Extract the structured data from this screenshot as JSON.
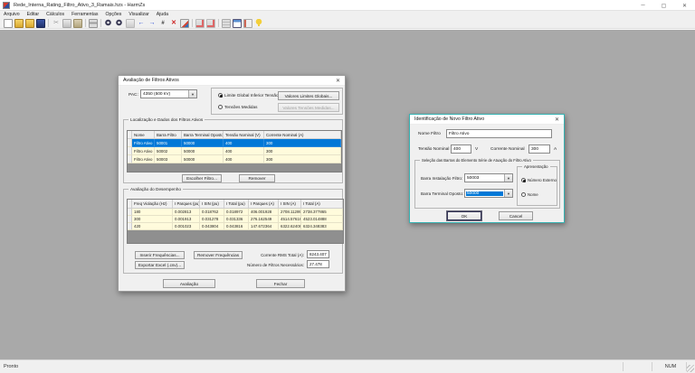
{
  "window": {
    "title": "Rede_Interna_Rating_Filtro_Ativo_3_Ramais.hzs - HarmZs",
    "minimize": "─",
    "maximize": "▢",
    "close": "✕",
    "status_left": "Pronto",
    "status_num": "NUM"
  },
  "menu": {
    "items": [
      "Arquivo",
      "Editar",
      "Cálculos",
      "Ferramentas",
      "Opções",
      "Visualizar",
      "Ajuda"
    ]
  },
  "toolbar": {
    "icons": [
      {
        "name": "new-document-icon",
        "glyph": ""
      },
      {
        "name": "open-file-icon",
        "glyph": ""
      },
      {
        "name": "import-case-icon",
        "glyph": ""
      },
      {
        "name": "save-file-icon",
        "glyph": ""
      },
      {
        "name": "cut-icon",
        "glyph": "✂"
      },
      {
        "name": "copy-icon",
        "glyph": ""
      },
      {
        "name": "paste-icon",
        "glyph": ""
      },
      {
        "name": "print-icon",
        "glyph": ""
      },
      {
        "name": "zoom-in-icon",
        "glyph": ""
      },
      {
        "name": "zoom-out-icon",
        "glyph": ""
      },
      {
        "name": "send-results-icon",
        "glyph": ""
      },
      {
        "name": "back-arrow-icon",
        "glyph": "←"
      },
      {
        "name": "forward-arrow-icon",
        "glyph": "→"
      },
      {
        "name": "grid-view-icon",
        "glyph": "#"
      },
      {
        "name": "delete-plot-icon",
        "glyph": "✕"
      },
      {
        "name": "plot-chart-icon",
        "glyph": ""
      },
      {
        "name": "chart-tool-1-icon",
        "glyph": ""
      },
      {
        "name": "chart-tool-2-icon",
        "glyph": ""
      },
      {
        "name": "data-grid-icon",
        "glyph": ""
      },
      {
        "name": "results-table-icon",
        "glyph": ""
      },
      {
        "name": "report-card-icon",
        "glyph": ""
      },
      {
        "name": "options-key-icon",
        "glyph": ""
      }
    ]
  },
  "colors": {
    "accent": "#0078d7",
    "row_bg": "#fffbdc",
    "workspace": "#a9a9a9",
    "active_border": "#35b2b2"
  },
  "left_dialog": {
    "title": "Avaliação de Filtros Ativos",
    "close": "✕",
    "pac_label": "PAC:",
    "pac_value": "4350  (500 kV)",
    "radio_limit": "Limite Global Inferior Tensão",
    "radio_measured": "Tensões Medidas",
    "btn_global_limits": "Valores Limites Globais...",
    "btn_measured_values": "Valores Tensões Medidas...",
    "group_filters": "Localização e Dados dos Filtros Ativos",
    "filter_table": {
      "headers": [
        "Nome",
        "Barra Filtro",
        "Barra Terminal Oposto",
        "Tensão Nominal (V)",
        "Corrente Nominal (A)"
      ],
      "rows": [
        [
          "Filtro Ativo",
          "50001",
          "50000",
          "400",
          "300"
        ],
        [
          "Filtro Ativo",
          "50002",
          "50000",
          "400",
          "300"
        ],
        [
          "Filtro Ativo",
          "50003",
          "50000",
          "400",
          "300"
        ]
      ]
    },
    "btn_choose": "Escolher Filtro...",
    "btn_remove": "Remover",
    "group_perf": "Avaliação do Desempenho",
    "perf_table": {
      "headers": [
        "Freq Violação (Hz)",
        "I Parques (pu)",
        "I SIN (pu)",
        "I Total (pu)",
        "I Parques (A)",
        "I SIN (A)",
        "I Total (A)"
      ],
      "rows": [
        [
          "180",
          "0.002813",
          "0.018762",
          "0.018972",
          "406.001928",
          "2708.112953",
          "2738.377865"
        ],
        [
          "300",
          "0.001913",
          "0.031278",
          "0.031336",
          "276.162549",
          "4514.576162",
          "4523.014888"
        ],
        [
          "420",
          "0.001023",
          "0.043804",
          "0.043816",
          "147.672364",
          "6322.624086",
          "6324.348383"
        ]
      ]
    },
    "btn_insert_freq": "Inserir Frequências...",
    "btn_remove_freq": "Remover Frequências",
    "btn_export": "Exportar Excel (.csv)...",
    "rms_label": "Corrente RMS Total (A):",
    "rms_value": "8243.407",
    "filters_needed_label": "Número de Filtros Necessários:",
    "filters_needed_value": "27.478",
    "btn_eval": "Avaliação",
    "btn_close": "Fechar"
  },
  "right_dialog": {
    "title": "Identificação de Novo Filtro Ativo",
    "close": "✕",
    "name_label": "Nome Filtro",
    "name_value": "Filtro Ativo",
    "voltage_label": "Tensão Nominal",
    "voltage_value": "400",
    "voltage_unit": "V",
    "current_label": "Corrente Nominal",
    "current_value": "300",
    "current_unit": "A",
    "group_bars": "Seleção das Barras do Elemento Série de Atuação do Filtro Ativo",
    "bar_install_label": "Barra Instalação Filtro:",
    "bar_install_value": "50003",
    "bar_opposite_label": "Barra Terminal Oposto:",
    "bar_opposite_value": "50000",
    "group_presentation": "Apresentação",
    "radio_external": "Número Externo",
    "radio_name": "Nome",
    "btn_ok": "OK",
    "btn_cancel": "Cancel"
  }
}
